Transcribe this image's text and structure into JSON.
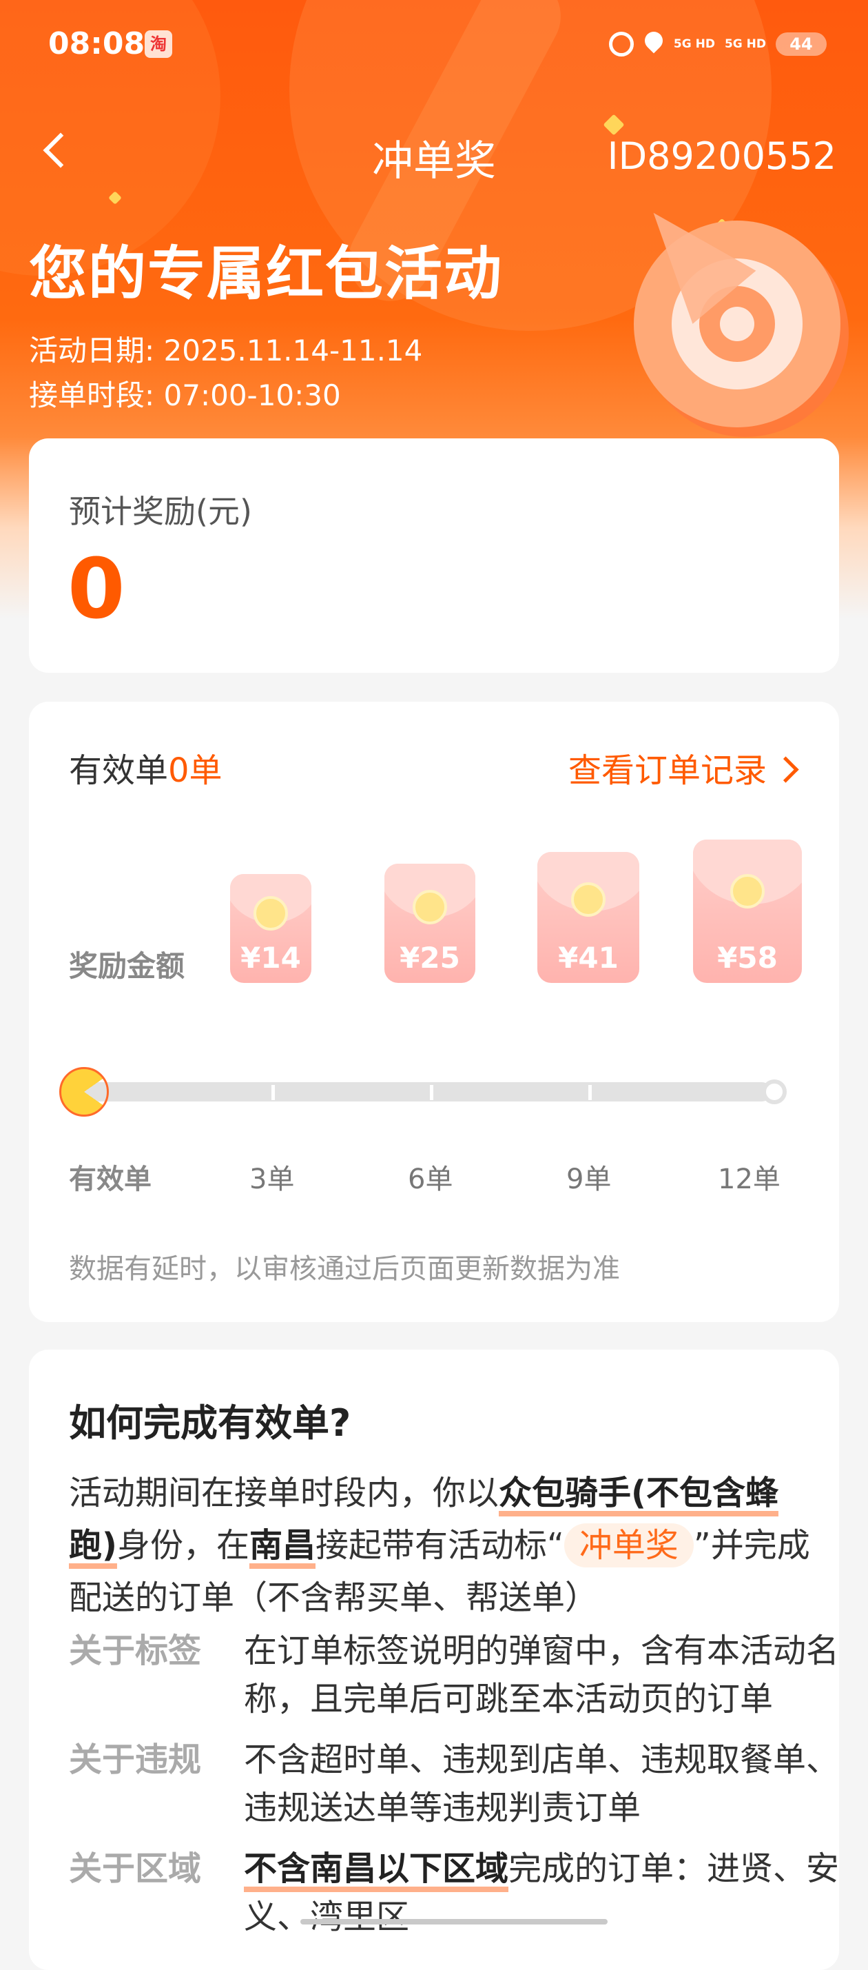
{
  "status_bar": {
    "time": "08:08",
    "app_badge": "淘",
    "network_1": "5G HD",
    "network_2": "5G HD",
    "battery": "44",
    "icons": [
      "alarm-icon",
      "location-icon",
      "signal-icon",
      "battery-icon"
    ]
  },
  "nav": {
    "back_icon": "chevron-left-icon",
    "title": "冲单奖",
    "id": "ID89200552"
  },
  "hero": {
    "title": "您的专属红包活动",
    "date_line": "活动日期: 2025.11.14-11.14",
    "time_line": "接单时段: 07:00-10:30",
    "illustration": "target-arrow-icon"
  },
  "reward_card": {
    "label": "预计奖励(元)",
    "value": "0"
  },
  "orders_card": {
    "valid_prefix": "有效单",
    "valid_count": "0单",
    "link_label": "查看订单记录",
    "reward_label": "奖励金额",
    "tiers": [
      {
        "amount": "¥14",
        "orders": "3单"
      },
      {
        "amount": "¥25",
        "orders": "6单"
      },
      {
        "amount": "¥41",
        "orders": "9单"
      },
      {
        "amount": "¥58",
        "orders": "12单"
      }
    ],
    "progress": 0,
    "scale_first": "有效单",
    "note": "数据有延时，以审核通过后页面更新数据为准"
  },
  "howto_card": {
    "title": "如何完成有效单?",
    "p1_a": "活动期间在接单时段内，你以",
    "p1_hl1": "众包骑手(不包含蜂跑)",
    "p1_b": "身份，在",
    "p1_hl2": "南昌",
    "p1_c": "接起带有活动标“",
    "p1_tag": "冲单奖",
    "p1_d": "”并完成配送的订单（不含帮买单、帮送单）",
    "rows": [
      {
        "key": "关于标签",
        "value": "在订单标签说明的弹窗中，含有本活动名称，且完单后可跳至本活动页的订单"
      },
      {
        "key": "关于违规",
        "value": "不含超时单、违规到店单、违规取餐单、违规送达单等违规判责订单"
      },
      {
        "key": "关于区域",
        "value_hl": "不含南昌以下区域",
        "value": "完成的订单：进贤、安义、湾里区"
      }
    ]
  },
  "colors": {
    "brand": "#ff5a00",
    "hero_top": "#ff5a0e",
    "envelope": "#ffbdb8",
    "coin": "#ffe48a"
  }
}
